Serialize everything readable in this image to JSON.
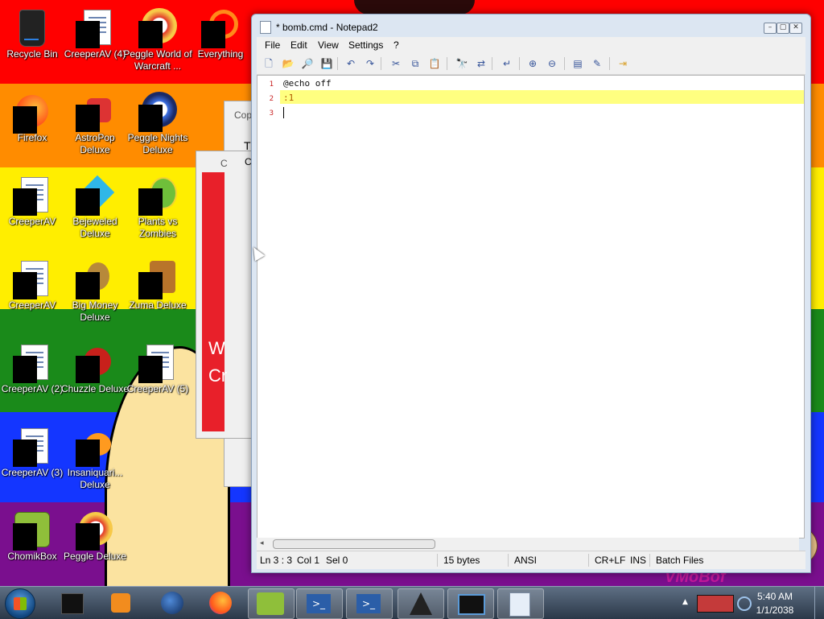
{
  "desktop": {
    "icons": [
      {
        "label": "Recycle Bin",
        "icon": "recycle-bin-icon"
      },
      {
        "label": "CreeperAV (4)",
        "icon": "document-icon"
      },
      {
        "label": "Peggle World of Warcraft ...",
        "icon": "peggle-icon"
      },
      {
        "label": "Everything",
        "icon": "everything-icon"
      },
      {
        "label": "Firefox",
        "icon": "firefox-icon"
      },
      {
        "label": "AstroPop Deluxe",
        "icon": "astropop-icon"
      },
      {
        "label": "Peggle Nights Deluxe",
        "icon": "peggle-nights-icon"
      },
      {
        "label": "CreeperAV",
        "icon": "document-icon"
      },
      {
        "label": "Bejeweled Deluxe",
        "icon": "bejeweled-icon"
      },
      {
        "label": "Plants vs Zombies",
        "icon": "plants-vs-zombies-icon"
      },
      {
        "label": "CreeperAV",
        "icon": "document-icon"
      },
      {
        "label": "Big Money Deluxe",
        "icon": "big-money-icon"
      },
      {
        "label": "Zuma Deluxe",
        "icon": "zuma-icon"
      },
      {
        "label": "CreeperAV (2)",
        "icon": "document-icon"
      },
      {
        "label": "Chuzzle Deluxe",
        "icon": "chuzzle-icon"
      },
      {
        "label": "CreeperAV (5)",
        "icon": "document-icon"
      },
      {
        "label": "CreeperAV (3)",
        "icon": "document-icon"
      },
      {
        "label": "Insaniquari... Deluxe",
        "icon": "insaniquarium-icon"
      },
      {
        "label": "ChomikBox",
        "icon": "chomikbox-icon"
      },
      {
        "label": "Peggle Deluxe",
        "icon": "peggle-icon"
      }
    ],
    "background_windows": {
      "copy_title": "Cop",
      "copy_text_1": "T",
      "copy_text_2": "C",
      "second_title": "C",
      "red_text_1": "W",
      "red_text_2": "Cr"
    },
    "wallpaper_text": "VMoBof",
    "colors": {
      "red": "#ff0000",
      "orange": "#ff8c00",
      "yellow": "#ffee00",
      "green": "#1a8a1a",
      "blue": "#1436ff",
      "purple": "#7a0f8e"
    }
  },
  "notepad": {
    "title": "* bomb.cmd - Notepad2",
    "menu": [
      "File",
      "Edit",
      "View",
      "Settings",
      "?"
    ],
    "toolbar_icons": [
      "new-icon",
      "open-icon",
      "browse-icon",
      "save-icon",
      "undo-icon",
      "redo-icon",
      "cut-icon",
      "copy-icon",
      "paste-icon",
      "find-icon",
      "replace-icon",
      "wordwrap-icon",
      "zoom-in-icon",
      "zoom-out-icon",
      "scheme-icon",
      "customize-icon",
      "exit-icon"
    ],
    "lines": [
      {
        "number": "1",
        "text": "@echo off"
      },
      {
        "number": "2",
        "text": ":1"
      },
      {
        "number": "3",
        "text": ""
      }
    ],
    "status": {
      "position": "Ln 3 : 3",
      "col": "Col 1",
      "sel": "Sel 0",
      "size": "15 bytes",
      "encoding": "ANSI",
      "line_endings": "CR+LF",
      "mode": "INS",
      "scheme": "Batch Files"
    }
  },
  "taskbar": {
    "time": "5:40 AM",
    "date": "1/1/2038",
    "buttons": [
      "media-player-icon",
      "globe-icon",
      "firefox-icon",
      "chomikbox-icon",
      "powershell-icon",
      "powershell-icon",
      "warning-app-icon",
      "monitor-icon",
      "notepad-icon"
    ]
  }
}
